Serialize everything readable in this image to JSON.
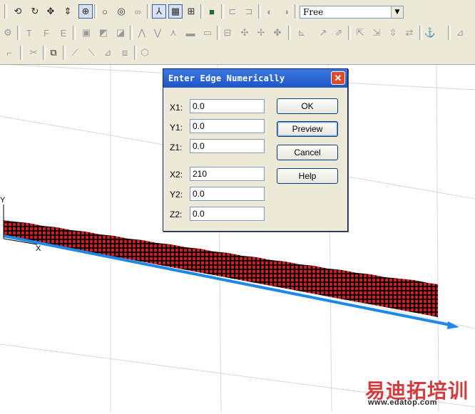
{
  "toolbar": {
    "view_mode": {
      "selected": "Free"
    }
  },
  "dialog": {
    "title": "Enter Edge Numerically",
    "close_glyph": "✕",
    "fields": [
      {
        "label": "X1:",
        "value": "0.0"
      },
      {
        "label": "Y1:",
        "value": "0.0"
      },
      {
        "label": "Z1:",
        "value": "0.0"
      },
      {
        "label": "X2:",
        "value": "210"
      },
      {
        "label": "Y2:",
        "value": "0.0"
      },
      {
        "label": "Z2:",
        "value": "0.0"
      }
    ],
    "buttons": {
      "ok": "OK",
      "preview": "Preview",
      "cancel": "Cancel",
      "help": "Help"
    }
  },
  "viewport": {
    "axis_labels": {
      "y": "Y",
      "x": "X"
    },
    "edge_color": "#1e88e5",
    "hatch_color": "#d81a1a"
  },
  "watermark": {
    "cn": "易迪拓培训",
    "url": "www.edatop.com"
  }
}
